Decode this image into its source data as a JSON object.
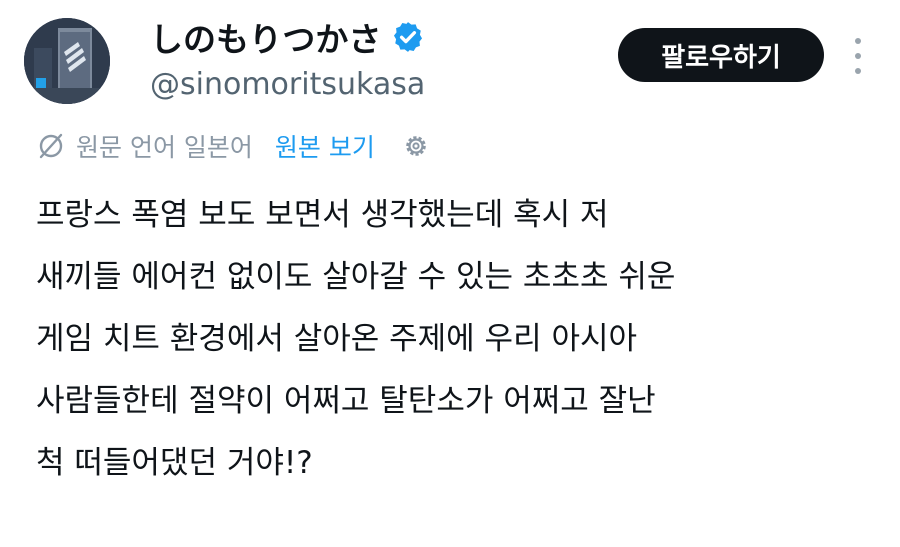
{
  "author": {
    "display_name": "しのもりつかさ",
    "handle": "@sinomoritsukasa",
    "verified": true
  },
  "actions": {
    "follow_label": "팔로우하기"
  },
  "translation": {
    "original_language_text": "원문 언어 일본어",
    "show_original_label": "원본 보기"
  },
  "tweet": {
    "lines": [
      "프랑스 폭염 보도 보면서 생각했는데 혹시 저",
      "새끼들 에어컨 없이도 살아갈 수 있는 초초초 쉬운",
      "게임 치트 환경에서 살아온 주제에 우리 아시아",
      "사람들한테 절약이 어쩌고 탈탄소가 어쩌고 잘난",
      "척 떠들어댔던 거야!?"
    ]
  },
  "colors": {
    "text_primary": "#0f1419",
    "text_secondary": "#536471",
    "link_blue": "#1d9bf0",
    "verified_blue": "#1d9bf0",
    "button_bg": "#0f1419"
  }
}
